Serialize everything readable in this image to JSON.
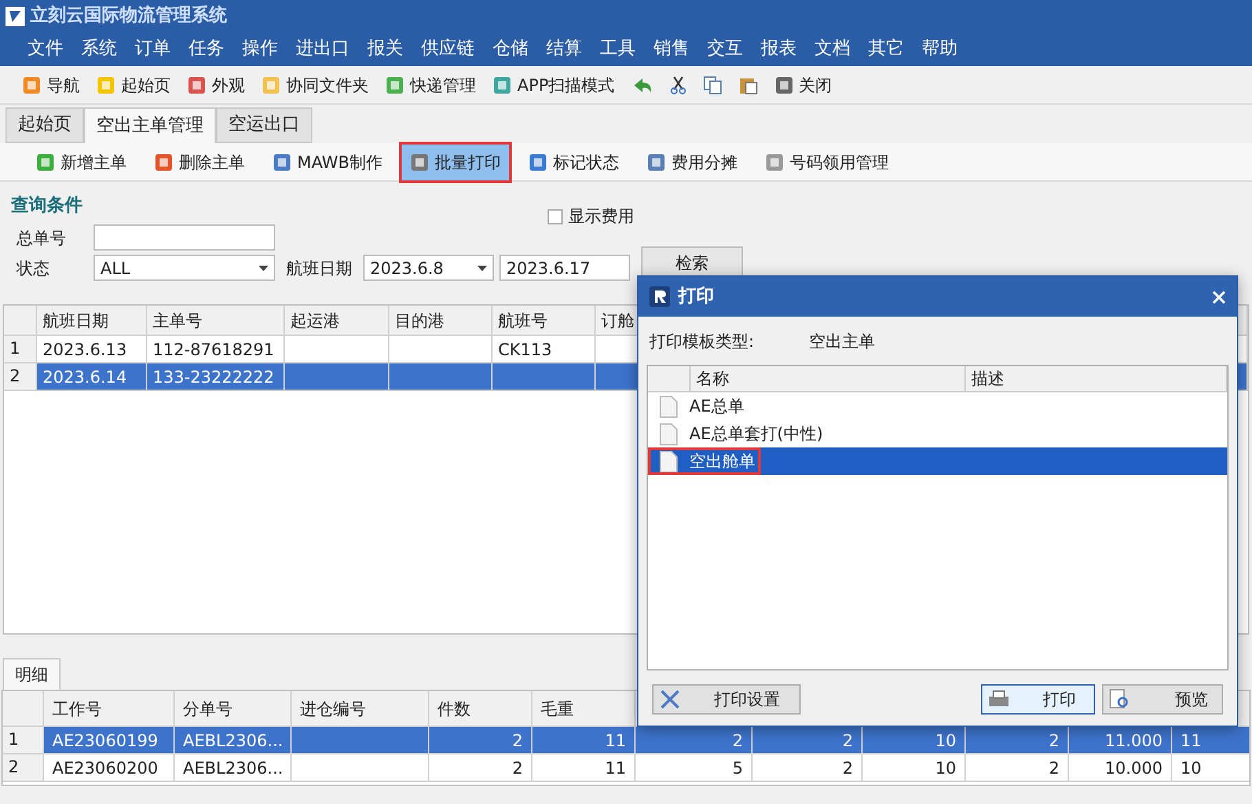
{
  "window": {
    "title": "立刻云国际物流管理系统"
  },
  "menu": [
    "文件",
    "系统",
    "订单",
    "任务",
    "操作",
    "进出口",
    "报关",
    "供应链",
    "仓储",
    "结算",
    "工具",
    "销售",
    "交互",
    "报表",
    "文档",
    "其它",
    "帮助"
  ],
  "toolbar": [
    {
      "label": "导航"
    },
    {
      "label": "起始页"
    },
    {
      "label": "外观"
    },
    {
      "label": "协同文件夹"
    },
    {
      "label": "快递管理"
    },
    {
      "label": "APP扫描模式"
    },
    {
      "label": "关闭"
    }
  ],
  "tabs": [
    {
      "label": "起始页",
      "selected": false
    },
    {
      "label": "空出主单管理",
      "selected": true
    },
    {
      "label": "空运出口",
      "selected": false
    }
  ],
  "actions": [
    {
      "label": "新增主单",
      "selected": false
    },
    {
      "label": "删除主单",
      "selected": false
    },
    {
      "label": "MAWB制作",
      "selected": false
    },
    {
      "label": "批量打印",
      "selected": true
    },
    {
      "label": "标记状态",
      "selected": false
    },
    {
      "label": "费用分摊",
      "selected": false
    },
    {
      "label": "号码领用管理",
      "selected": false
    }
  ],
  "query": {
    "title": "查询条件",
    "show_fees": {
      "label": "显示费用",
      "checked": false
    },
    "master_no_label": "总单号",
    "status_label": "状态",
    "status": "ALL",
    "date_label": "航班日期",
    "date_from": "2023.6.8",
    "date_to": "2023.6.17",
    "search": "检索"
  },
  "master_table": {
    "columns": [
      "航班日期",
      "主单号",
      "起运港",
      "目的港",
      "航班号",
      "订舱"
    ],
    "rows": [
      {
        "no": "1",
        "cells": [
          "2023.6.13",
          "112-87618291",
          "",
          "",
          "CK113",
          ""
        ],
        "selected": false
      },
      {
        "no": "2",
        "cells": [
          "2023.6.14",
          "133-23222222",
          "",
          "",
          "",
          ""
        ],
        "selected": true
      }
    ]
  },
  "detail_tab": "明细",
  "detail_table": {
    "columns": [
      "工作号",
      "分单号",
      "进仓编号",
      "件数",
      "毛重"
    ],
    "rows": [
      {
        "no": "1",
        "cells": [
          "AE23060199",
          "AEBL2306...",
          "",
          "2",
          "11",
          "2",
          "2",
          "10",
          "2",
          "11.000",
          "11"
        ],
        "selected": true
      },
      {
        "no": "2",
        "cells": [
          "AE23060200",
          "AEBL2306...",
          "",
          "2",
          "11",
          "5",
          "2",
          "10",
          "2",
          "10.000",
          "10"
        ],
        "selected": false
      }
    ]
  },
  "dialog": {
    "title": "打印",
    "type_label": "打印模板类型:",
    "type_value": "空出主单",
    "columns": [
      "名称",
      "描述"
    ],
    "templates": [
      {
        "name": "AE总单",
        "selected": false
      },
      {
        "name": "AE总单套打(中性)",
        "selected": false
      },
      {
        "name": "空出舱单",
        "selected": true
      }
    ],
    "buttons": [
      "打印设置",
      "打印",
      "预览"
    ]
  }
}
